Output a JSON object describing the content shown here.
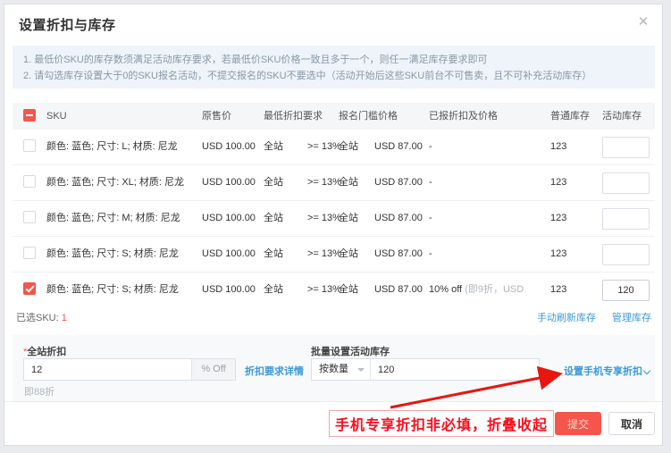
{
  "window": {
    "title": "设置折扣与库存",
    "close_icon": "close-icon"
  },
  "notice": {
    "lines": [
      "1. 最低价SKU的库存数须满足活动库存要求，若最低价SKU价格一致且多于一个，则任一满足库存要求即可",
      "2. 请勾选库存设置大于0的SKU报名活动，不提交报名的SKU不要选中（活动开始后这些SKU前台不可售卖，且不可补充活动库存）"
    ]
  },
  "table": {
    "headers": {
      "sku": "SKU",
      "orig_price": "原售价",
      "min_discount": "最低折扣要求",
      "threshold_price": "报名门槛价格",
      "applied_discount": "已报折扣及价格",
      "normal_stock": "普通库存",
      "activity_stock": "活动库存"
    },
    "header_checkbox_state": "indeterminate",
    "rows": [
      {
        "checked": false,
        "sku": "颜色: 蓝色; 尺寸: L; 材质: 尼龙",
        "orig_price": "USD 100.00",
        "min_scope": "全站",
        "min_rate": ">= 13%",
        "thr_scope": "全站",
        "thr_price": "USD 87.00",
        "applied": "-",
        "applied_muted": "",
        "normal_stock": "123",
        "activity_stock": ""
      },
      {
        "checked": false,
        "sku": "颜色: 蓝色; 尺寸: XL; 材质: 尼龙",
        "orig_price": "USD 100.00",
        "min_scope": "全站",
        "min_rate": ">= 13%",
        "thr_scope": "全站",
        "thr_price": "USD 87.00",
        "applied": "-",
        "applied_muted": "",
        "normal_stock": "123",
        "activity_stock": ""
      },
      {
        "checked": false,
        "sku": "颜色: 蓝色; 尺寸: M; 材质: 尼龙",
        "orig_price": "USD 100.00",
        "min_scope": "全站",
        "min_rate": ">= 13%",
        "thr_scope": "全站",
        "thr_price": "USD 87.00",
        "applied": "-",
        "applied_muted": "",
        "normal_stock": "123",
        "activity_stock": ""
      },
      {
        "checked": false,
        "sku": "颜色: 蓝色; 尺寸: S; 材质: 尼龙",
        "orig_price": "USD 100.00",
        "min_scope": "全站",
        "min_rate": ">= 13%",
        "thr_scope": "全站",
        "thr_price": "USD 87.00",
        "applied": "-",
        "applied_muted": "",
        "normal_stock": "123",
        "activity_stock": ""
      },
      {
        "checked": true,
        "sku": "颜色: 蓝色; 尺寸: S; 材质: 尼龙",
        "orig_price": "USD 100.00",
        "min_scope": "全站",
        "min_rate": ">= 13%",
        "thr_scope": "全站",
        "thr_price": "USD 87.00",
        "applied": "10% off ",
        "applied_muted": "(即9折，USD",
        "normal_stock": "123",
        "activity_stock": "120"
      }
    ]
  },
  "selection_bar": {
    "label_prefix": "已选SKU: ",
    "count": "1",
    "refresh_link": "手动刷新库存",
    "manage_link": "管理库存"
  },
  "form": {
    "discount_label": "全站折扣",
    "discount_required_mark": "*",
    "discount_value": "12",
    "discount_suffix": "% Off",
    "discount_detail_link": "折扣要求详情",
    "discount_hint": "即88折",
    "batch_label": "批量设置活动库存",
    "batch_select_value": "按数量",
    "batch_input_value": "120",
    "mobile_discount_link": "设置手机专享折扣"
  },
  "footer": {
    "submit_label": "提交",
    "cancel_label": "取消"
  },
  "annotation": {
    "text": "手机专享折扣非必填，折叠收起",
    "color": "#fc0d1b"
  }
}
